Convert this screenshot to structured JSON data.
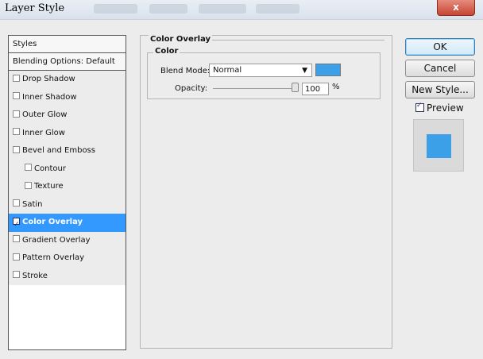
{
  "window": {
    "title": "Layer Style",
    "close_label": "x"
  },
  "styles_panel": {
    "header": "Styles",
    "blending_options": "Blending Options: Default",
    "effects": [
      {
        "label": "Drop Shadow",
        "checked": false,
        "selected": false,
        "indent": false
      },
      {
        "label": "Inner Shadow",
        "checked": false,
        "selected": false,
        "indent": false
      },
      {
        "label": "Outer Glow",
        "checked": false,
        "selected": false,
        "indent": false
      },
      {
        "label": "Inner Glow",
        "checked": false,
        "selected": false,
        "indent": false
      },
      {
        "label": "Bevel and Emboss",
        "checked": false,
        "selected": false,
        "indent": false
      },
      {
        "label": "Contour",
        "checked": false,
        "selected": false,
        "indent": true
      },
      {
        "label": "Texture",
        "checked": false,
        "selected": false,
        "indent": true
      },
      {
        "label": "Satin",
        "checked": false,
        "selected": false,
        "indent": false
      },
      {
        "label": "Color Overlay",
        "checked": true,
        "selected": true,
        "indent": false
      },
      {
        "label": "Gradient Overlay",
        "checked": false,
        "selected": false,
        "indent": false
      },
      {
        "label": "Pattern Overlay",
        "checked": false,
        "selected": false,
        "indent": false
      },
      {
        "label": "Stroke",
        "checked": false,
        "selected": false,
        "indent": false
      }
    ]
  },
  "color_overlay": {
    "group_title": "Color Overlay",
    "sub_title": "Color",
    "blend_mode_label": "Blend Mode:",
    "blend_mode_value": "Normal",
    "overlay_color": "#3ba0e8",
    "opacity_label": "Opacity:",
    "opacity_value": "100",
    "opacity_unit": "%",
    "opacity_fraction": 1.0
  },
  "buttons": {
    "ok": "OK",
    "cancel": "Cancel",
    "new_style": "New Style..."
  },
  "preview": {
    "label": "Preview",
    "checked": true
  }
}
